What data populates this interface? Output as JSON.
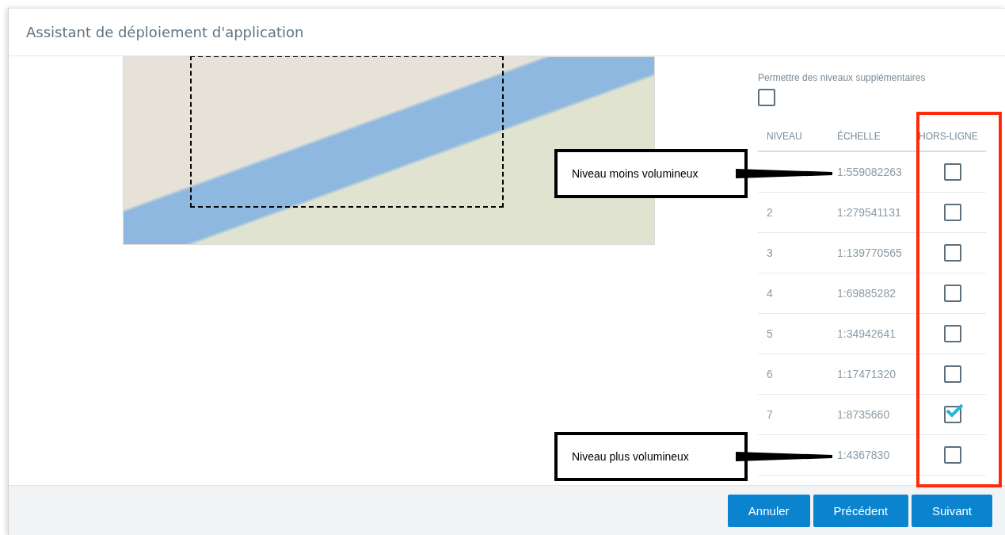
{
  "window": {
    "title": "Assistant de déploiement d'application"
  },
  "extra_levels": {
    "label": "Permettre des niveaux supplémentaires",
    "checked": false
  },
  "table": {
    "columns": [
      "NIVEAU",
      "ÉCHELLE",
      "HORS-LIGNE"
    ],
    "rows": [
      {
        "scale": "1:559082263",
        "offline": false,
        "callout": "Niveau moins volumineux"
      },
      {
        "level": "2",
        "scale": "1:279541131",
        "offline": false
      },
      {
        "level": "3",
        "scale": "1:139770565",
        "offline": false
      },
      {
        "level": "4",
        "scale": "1:69885282",
        "offline": false
      },
      {
        "level": "5",
        "scale": "1:34942641",
        "offline": false
      },
      {
        "level": "6",
        "scale": "1:17471320",
        "offline": false
      },
      {
        "level": "7",
        "scale": "1:8735660",
        "offline": true
      },
      {
        "scale": "1:4367830",
        "offline": false,
        "callout": "Niveau plus volumineux"
      }
    ]
  },
  "buttons": [
    "Annuler",
    "Précédent",
    "Suivant"
  ]
}
